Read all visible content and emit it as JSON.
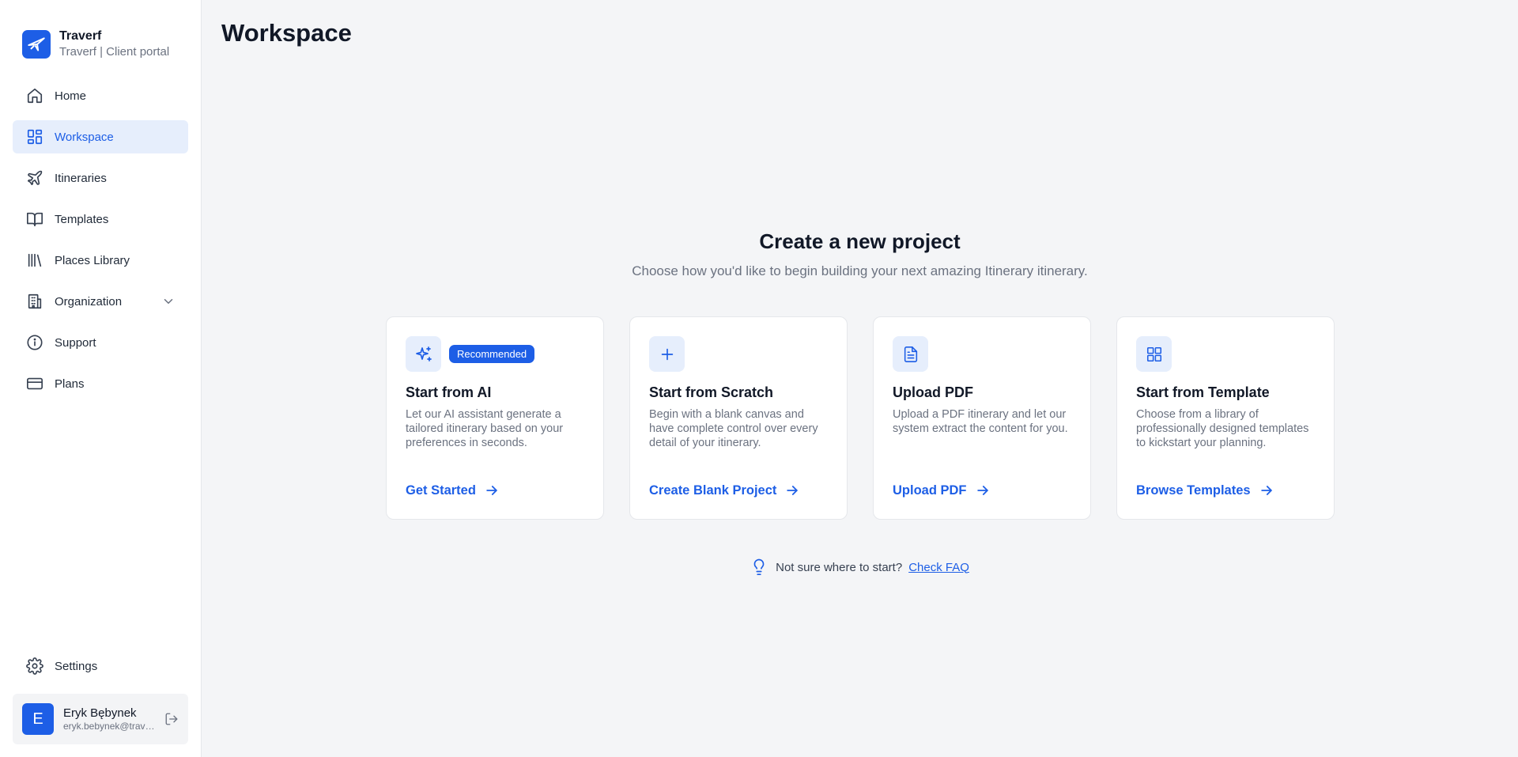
{
  "brand": {
    "name": "Traverf",
    "subtitle": "Traverf | Client portal"
  },
  "nav": [
    {
      "label": "Home"
    },
    {
      "label": "Workspace"
    },
    {
      "label": "Itineraries"
    },
    {
      "label": "Templates"
    },
    {
      "label": "Places Library"
    },
    {
      "label": "Organization"
    },
    {
      "label": "Support"
    },
    {
      "label": "Plans"
    }
  ],
  "settings": {
    "label": "Settings"
  },
  "user": {
    "initial": "E",
    "name": "Eryk Bębynek",
    "email": "eryk.bebynek@traverf.com"
  },
  "page": {
    "title": "Workspace"
  },
  "hero": {
    "title": "Create a new project",
    "subtitle": "Choose how you'd like to begin building your next amazing Itinerary itinerary."
  },
  "cards": [
    {
      "badge": "Recommended",
      "title": "Start from AI",
      "desc": "Let our AI assistant generate a tailored itinerary based on your preferences in seconds.",
      "link": "Get Started"
    },
    {
      "title": "Start from Scratch",
      "desc": "Begin with a blank canvas and have complete control over every detail of your itinerary.",
      "link": "Create Blank Project"
    },
    {
      "title": "Upload PDF",
      "desc": "Upload a PDF itinerary and let our system extract the content for you.",
      "link": "Upload PDF"
    },
    {
      "title": "Start from Template",
      "desc": "Choose from a library of professionally designed templates to kickstart your planning.",
      "link": "Browse Templates"
    }
  ],
  "faq": {
    "text": "Not sure where to start?",
    "link": "Check FAQ"
  },
  "colors": {
    "accent": "#1d5ee6",
    "accent_light": "#e6eefc"
  }
}
